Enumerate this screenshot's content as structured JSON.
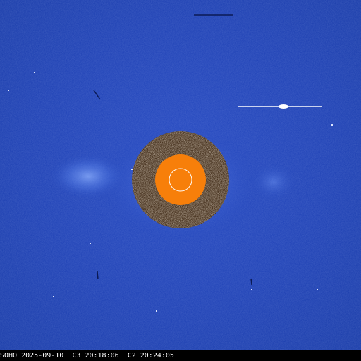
{
  "image": {
    "type": "coronagraph-composite",
    "background_color": "#1b3fb5",
    "occulter_color": "#f77f0a",
    "disk_outline_color": "#ffffff",
    "inner_field_color": "#3a2410"
  },
  "caption": {
    "observatory": "SOHO",
    "date": "2025-09-10",
    "c3_label": "C3",
    "c3_time": "20:18:06",
    "c2_label": "C2",
    "c2_time": "20:24:05"
  }
}
